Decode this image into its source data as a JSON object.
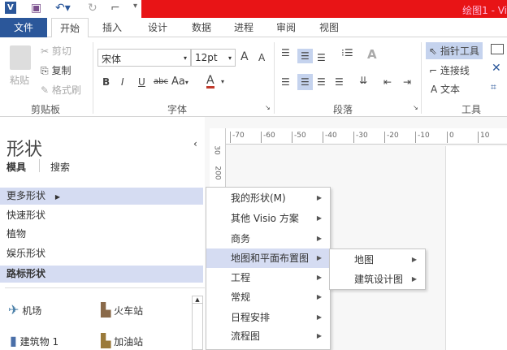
{
  "title": "绘图1 - Vi",
  "quick_access": [
    "visio-logo",
    "save-icon",
    "undo-icon",
    "redo-icon",
    "connector-icon",
    "customize-icon"
  ],
  "tabs": [
    "文件",
    "开始",
    "插入",
    "设计",
    "数据",
    "进程",
    "审阅",
    "视图"
  ],
  "ribbon": {
    "clipboard": {
      "paste": "粘贴",
      "cut": "剪切",
      "copy": "复制",
      "format_painter": "格式刷",
      "label": "剪贴板"
    },
    "font": {
      "font_name": "宋体",
      "font_size": "12pt",
      "bold": "B",
      "italic": "I",
      "underline": "U",
      "strike": "abc",
      "case": "Aa",
      "color": "A",
      "grow": "A",
      "shrink": "A",
      "label": "字体"
    },
    "paragraph": {
      "label": "段落"
    },
    "tools": {
      "pointer": "指针工具",
      "connector": "连接线",
      "text": "文本",
      "text_icon": "A",
      "label": "工具"
    }
  },
  "shapes_panel": {
    "title": "形状",
    "tab_stencils": "模具",
    "tab_search": "搜索",
    "items": [
      "更多形状",
      "快速形状",
      "植物",
      "娱乐形状",
      "路标形状"
    ],
    "shapes": [
      "机场",
      "火车站",
      "建筑物 1",
      "加油站"
    ]
  },
  "ruler": {
    "h_ticks": [
      "-70",
      "-60",
      "-50",
      "-40",
      "-30",
      "-20",
      "-10",
      "0",
      "10"
    ],
    "v_ticks": [
      "30",
      "200"
    ]
  },
  "menu": {
    "items": [
      "我的形状(M)",
      "其他 Visio 方案",
      "商务",
      "地图和平面布置图",
      "工程",
      "常规",
      "日程安排",
      "流程图"
    ],
    "highlighted": 3
  },
  "submenu": {
    "items": [
      "地图",
      "建筑设计图"
    ]
  }
}
